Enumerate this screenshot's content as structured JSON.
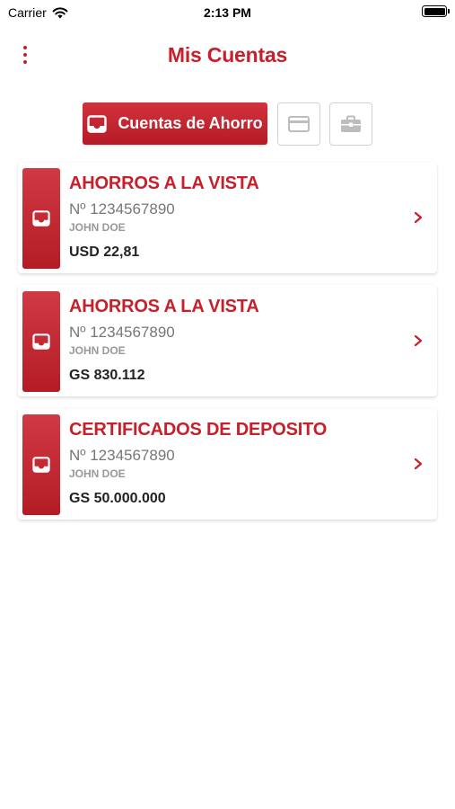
{
  "status_bar": {
    "carrier": "Carrier",
    "time": "2:13 PM"
  },
  "header": {
    "title": "Mis Cuentas"
  },
  "tabs": {
    "active_label": "Cuentas de Ahorro",
    "active_icon": "inbox-icon",
    "other_icons": [
      "credit-card-icon",
      "briefcase-icon"
    ]
  },
  "accounts": [
    {
      "type": "AHORROS A LA VISTA",
      "number": "Nº 1234567890",
      "holder": "JOHN DOE",
      "balance": "USD 22,81"
    },
    {
      "type": "AHORROS A LA VISTA",
      "number": "Nº 1234567890",
      "holder": "JOHN DOE",
      "balance": "GS 830.112"
    },
    {
      "type": "CERTIFICADOS DE DEPOSITO",
      "number": "Nº 1234567890",
      "holder": "JOHN DOE",
      "balance": "GS 50.000.000"
    }
  ],
  "colors": {
    "brand_red": "#c6202b",
    "muted_text": "#777777",
    "border_gray": "#d2d2d2"
  }
}
